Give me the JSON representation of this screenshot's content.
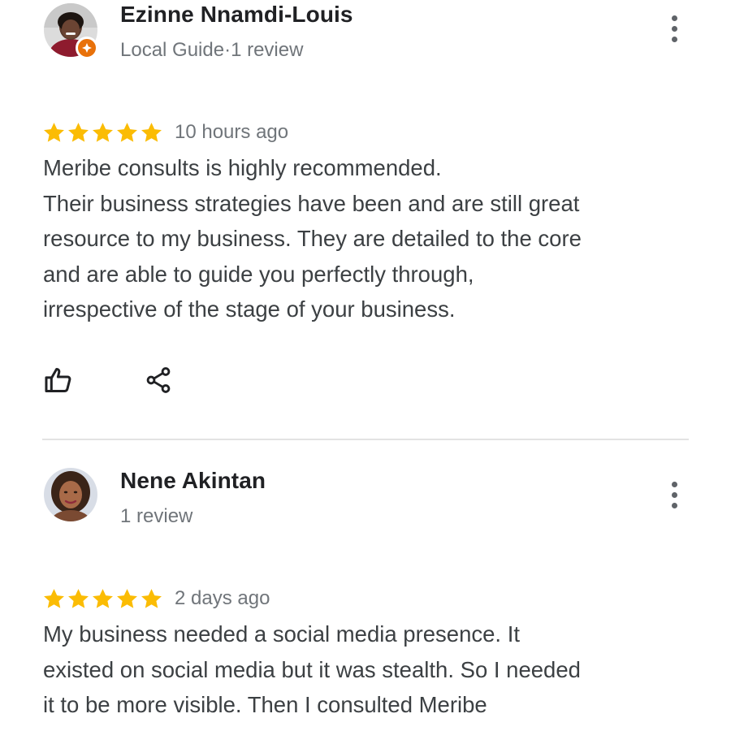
{
  "reviews": [
    {
      "author_name": "Ezinne Nnamdi-Louis",
      "author_meta": "Local Guide·1 review",
      "rating": 5,
      "date": "10 hours ago",
      "text_lines": [
        "Meribe consults is highly recommended.",
        "Their business strategies have been and are still great",
        "resource to my business. They are detailed to the core",
        "and are able to guide you perfectly through,",
        "irrespective of the stage of your business."
      ],
      "icons": {
        "like": "thumbs-up-icon",
        "share": "share-icon",
        "more": "more-vert-icon",
        "badge": "local-guide-badge-icon"
      }
    },
    {
      "author_name": "Nene Akintan",
      "author_meta": "1 review",
      "rating": 5,
      "date": "2 days ago",
      "text_lines": [
        "My business needed a social media presence. It",
        "existed on social media but it was stealth. So I needed",
        "it to be more visible. Then I consulted Meribe"
      ],
      "icons": {
        "more": "more-vert-icon"
      }
    }
  ],
  "colors": {
    "star": "#fbbc04",
    "text_primary": "#202124",
    "text_body": "#3c4043",
    "text_secondary": "#70757a",
    "icon": "#5f6368",
    "divider": "#e3e3e3",
    "badge": "#e8710a",
    "link": "#1a73e8"
  }
}
